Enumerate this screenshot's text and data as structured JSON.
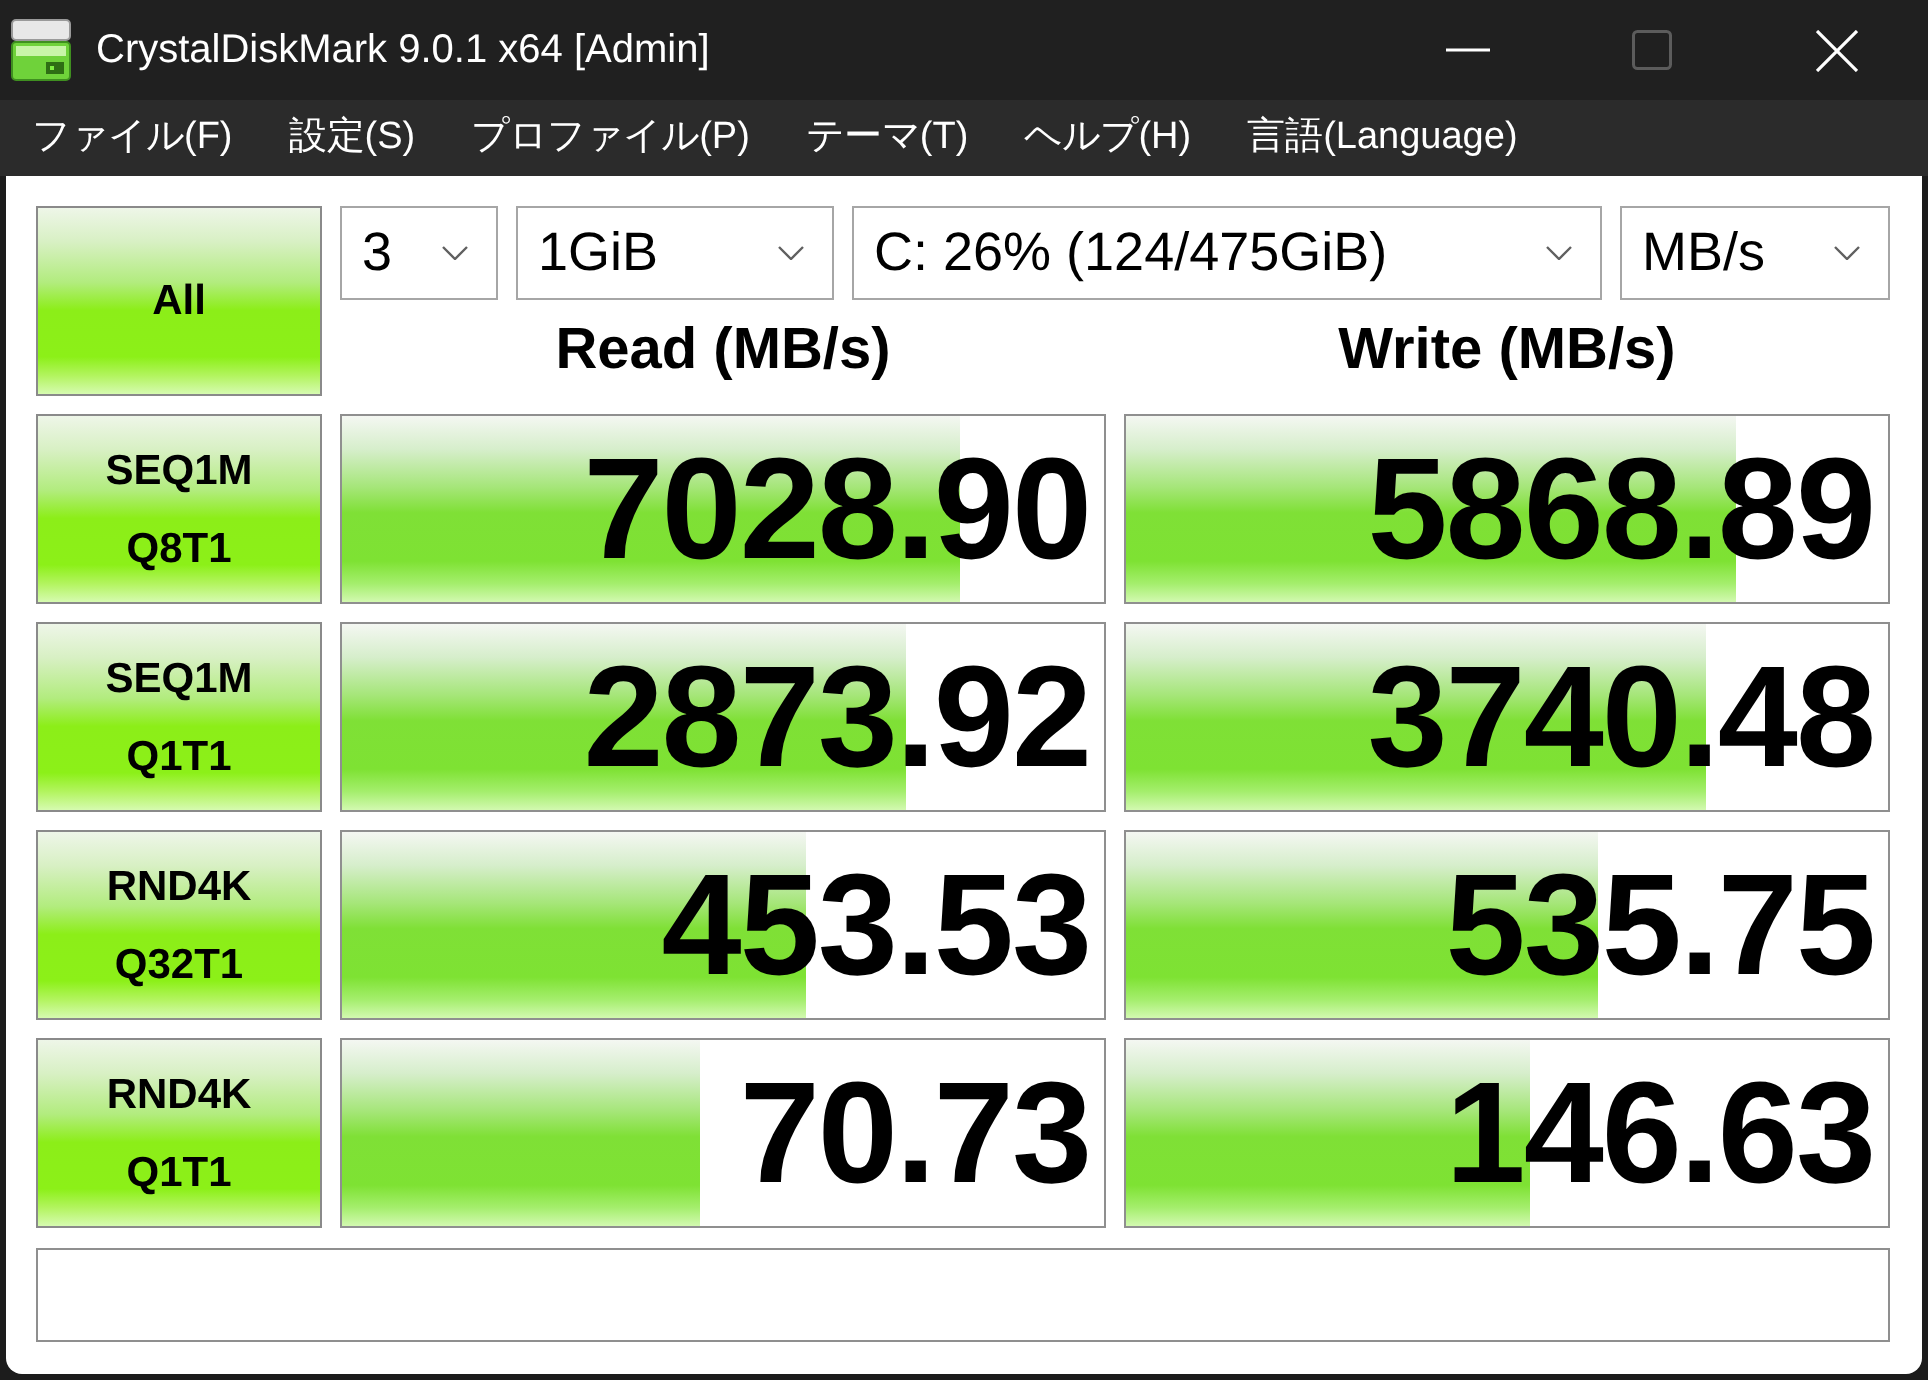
{
  "window": {
    "title": "CrystalDiskMark 9.0.1 x64 [Admin]",
    "controls": [
      {
        "kind": "minimize",
        "disabled": false
      },
      {
        "kind": "maximize",
        "disabled": true
      },
      {
        "kind": "close",
        "disabled": false
      }
    ]
  },
  "menu": [
    "ファイル(F)",
    "設定(S)",
    "プロファイル(P)",
    "テーマ(T)",
    "ヘルプ(H)",
    "言語(Language)"
  ],
  "all_button": "All",
  "dropdowns": [
    {
      "value": "3"
    },
    {
      "value": "1GiB"
    },
    {
      "value": "C: 26% (124/475GiB)"
    },
    {
      "value": "MB/s"
    }
  ],
  "columns": [
    "Read (MB/s)",
    "Write (MB/s)"
  ],
  "tests": [
    {
      "name": "SEQ1M",
      "params": "Q8T1",
      "read": {
        "value": "7028.90",
        "level": 0.81
      },
      "write": {
        "value": "5868.89",
        "level": 0.8
      }
    },
    {
      "name": "SEQ1M",
      "params": "Q1T1",
      "read": {
        "value": "2873.92",
        "level": 0.74
      },
      "write": {
        "value": "3740.48",
        "level": 0.76
      }
    },
    {
      "name": "RND4K",
      "params": "Q32T1",
      "read": {
        "value": "453.53",
        "level": 0.61
      },
      "write": {
        "value": "535.75",
        "level": 0.62
      }
    },
    {
      "name": "RND4K",
      "params": "Q1T1",
      "read": {
        "value": "70.73",
        "level": 0.47
      },
      "write": {
        "value": "146.63",
        "level": 0.53
      }
    }
  ]
}
